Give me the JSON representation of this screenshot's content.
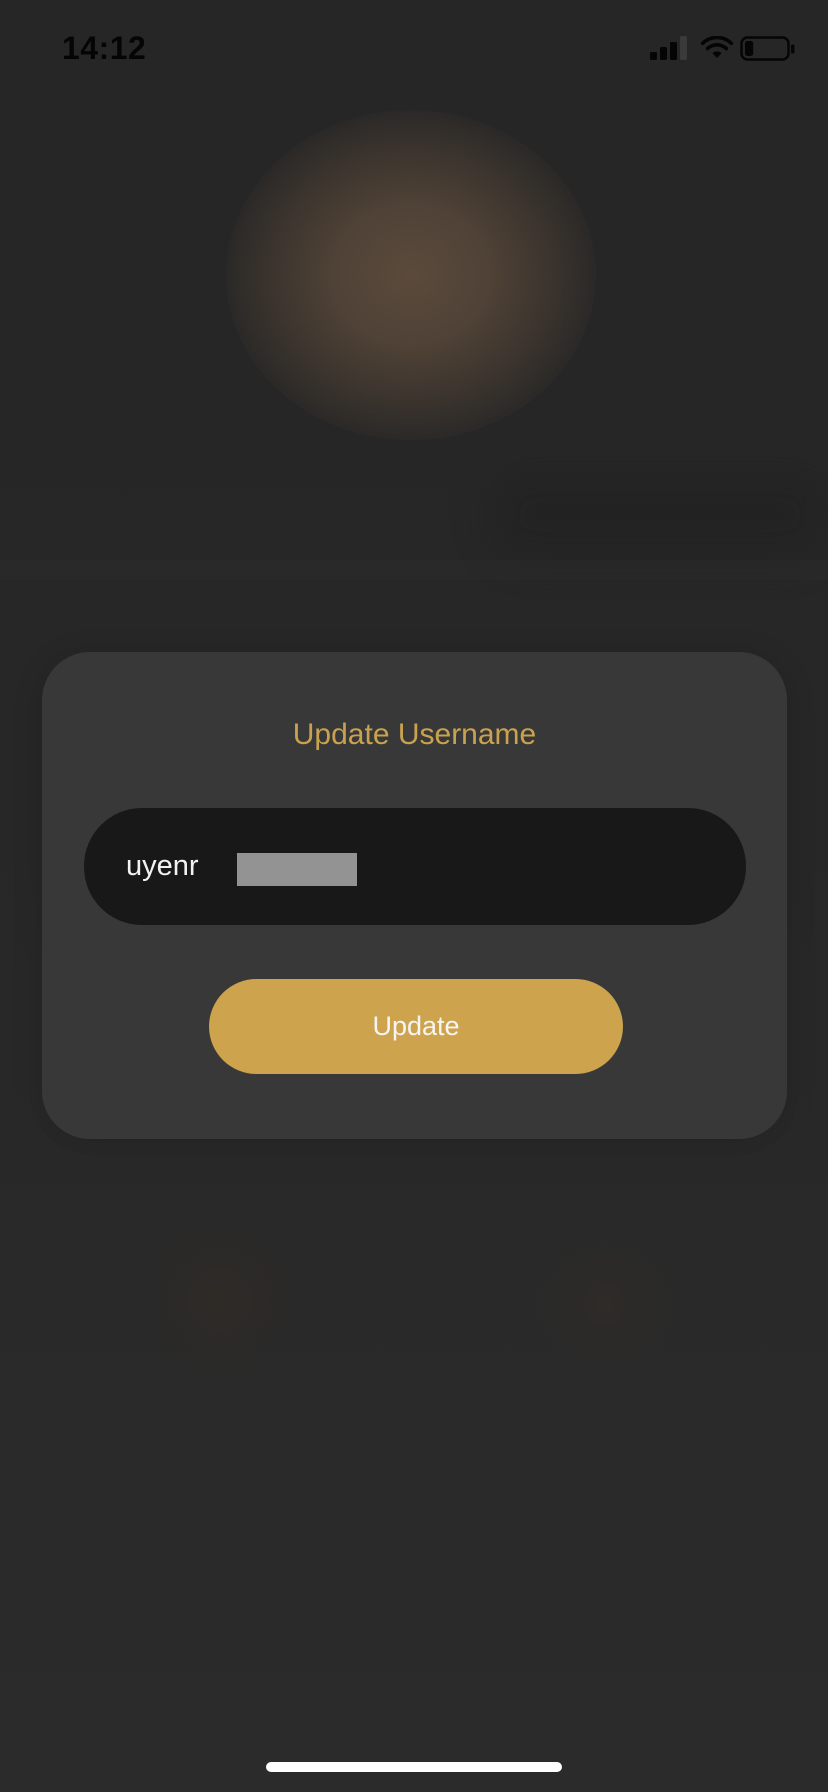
{
  "status_bar": {
    "time": "14:12",
    "signal_icon": "cellular-signal-icon",
    "wifi_icon": "wifi-icon",
    "battery_icon": "battery-low-icon",
    "battery_level": 0.2
  },
  "modal": {
    "title": "Update Username",
    "input_value": "uyenr",
    "button_label": "Update"
  },
  "colors": {
    "accent": "#cda34e",
    "title": "#c9a24f",
    "card_bg": "#383838",
    "input_bg": "#181818",
    "screen_bg": "#262626"
  }
}
